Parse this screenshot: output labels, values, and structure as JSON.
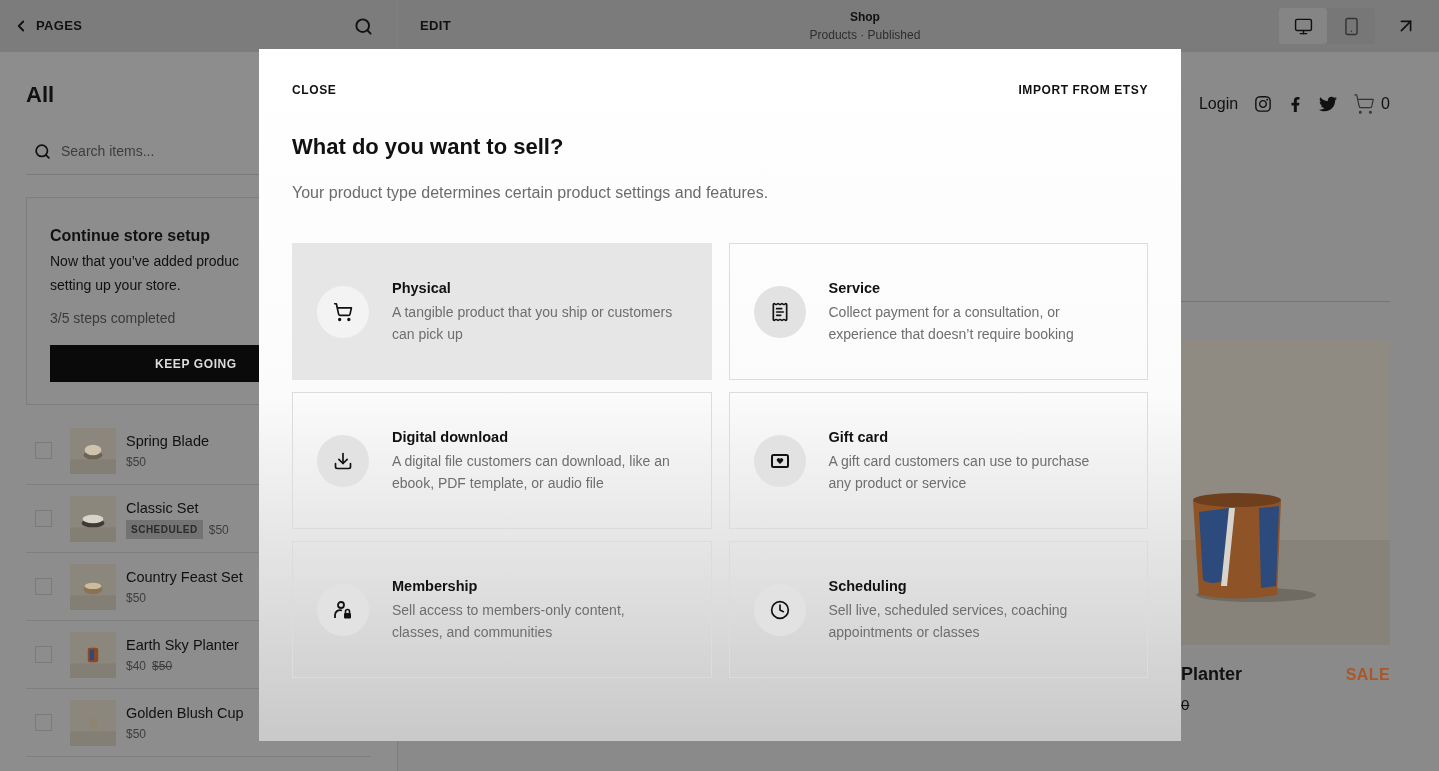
{
  "top_bar": {
    "back": "PAGES",
    "edit": "EDIT",
    "page_title": "Shop",
    "page_subtitle": "Products · Published",
    "devices": [
      {
        "kind": "desktop",
        "selected": true
      },
      {
        "kind": "mobile",
        "selected": false
      }
    ]
  },
  "sidebar": {
    "heading": "All",
    "search": {
      "placeholder": "Search items..."
    },
    "setup_card": {
      "title": "Continue store setup",
      "text_lines": [
        "Now that you’ve added produc",
        "setting up your store."
      ],
      "progress": "3/5 steps completed",
      "button": "KEEP GOING"
    },
    "products": [
      {
        "name": "Spring Blade",
        "price": "$50",
        "checked": false
      },
      {
        "name": "Classic Set",
        "badge": "SCHEDULED",
        "price": "$50",
        "checked": false
      },
      {
        "name": "Country Feast Set",
        "price": "$50",
        "checked": false
      },
      {
        "name": "Earth Sky Planter",
        "price": "$40",
        "old_price": "$50",
        "checked": false
      },
      {
        "name": "Golden Blush Cup",
        "price": "$50",
        "checked": false
      }
    ]
  },
  "preview": {
    "nav": {
      "login": "Login",
      "cart_count": "0"
    },
    "product": {
      "name": "Planter",
      "price_fragment": "0",
      "badge": "SALE"
    }
  },
  "dialog": {
    "close": "CLOSE",
    "import": "IMPORT FROM ETSY",
    "title": "What do you want to sell?",
    "subtitle": "Your product type determines certain product settings and features.",
    "options": [
      {
        "kind": "physical",
        "title": "Physical",
        "description": "A tangible product that you ship or customers can pick up",
        "selected": true
      },
      {
        "kind": "service",
        "title": "Service",
        "description": "Collect payment for a consultation, or experience that doesn’t require booking",
        "selected": false
      },
      {
        "kind": "download",
        "title": "Digital download",
        "description": "A digital file customers can download, like an ebook, PDF template, or audio file",
        "selected": false
      },
      {
        "kind": "giftcard",
        "title": "Gift card",
        "description": "A gift card customers can use to purchase any product or service",
        "selected": false
      },
      {
        "kind": "membership",
        "title": "Membership",
        "description": "Sell access to members-only content, classes, and communities",
        "selected": false
      },
      {
        "kind": "scheduling",
        "title": "Scheduling",
        "description": "Sell live, scheduled services, coaching appointments or classes",
        "selected": false
      }
    ]
  }
}
